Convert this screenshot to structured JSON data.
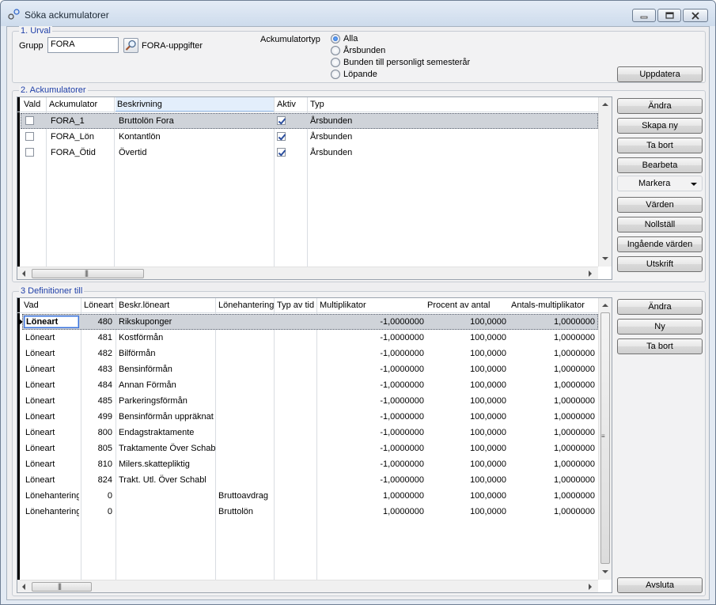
{
  "window": {
    "title": "Söka ackumulatorer",
    "minimize_icon": "minimize-icon",
    "maximize_icon": "maximize-icon",
    "close_icon": "close-icon"
  },
  "urval": {
    "legend": "1. Urval",
    "grupp_label": "Grupp",
    "grupp_value": "FORA",
    "lookup_icon": "search-icon",
    "grupp_description": "FORA-uppgifter",
    "ackumulatortyp_label": "Ackumulatortyp",
    "options": [
      {
        "label": "Alla",
        "selected": true
      },
      {
        "label": "Årsbunden",
        "selected": false
      },
      {
        "label": "Bunden till personligt semesterår",
        "selected": false
      },
      {
        "label": "Löpande",
        "selected": false
      }
    ],
    "update_button": "Uppdatera"
  },
  "ackumulatorer": {
    "legend": "2. Ackumulatorer",
    "columns": [
      "Vald",
      "Ackumulator",
      "Beskrivning",
      "Aktiv",
      "Typ"
    ],
    "rows": [
      {
        "vald": false,
        "ackumulator": "FORA_1",
        "beskrivning": "Bruttolön Fora",
        "aktiv": true,
        "typ": "Årsbunden",
        "selected": true
      },
      {
        "vald": false,
        "ackumulator": "FORA_Lön",
        "beskrivning": "Kontantlön",
        "aktiv": true,
        "typ": "Årsbunden",
        "selected": false
      },
      {
        "vald": false,
        "ackumulator": "FORA_Ötid",
        "beskrivning": "Övertid",
        "aktiv": true,
        "typ": "Årsbunden",
        "selected": false
      }
    ],
    "buttons": [
      "Ändra",
      "Skapa ny",
      "Ta bort",
      "Bearbeta",
      "Markera",
      "Värden",
      "Nollställ",
      "Ingående värden",
      "Utskrift"
    ]
  },
  "definitioner": {
    "legend": "3 Definitioner till",
    "columns": [
      "Vad",
      "Löneart",
      "Beskr.löneart",
      "Lönehantering",
      "Typ av tid",
      "Multiplikator",
      "Procent av antal",
      "Antals-multiplikator"
    ],
    "rows": [
      {
        "vad": "Löneart",
        "loneart": "480",
        "beskr": "Rikskuponger",
        "lonehantering": "",
        "typ": "",
        "mult": "-1,0000000",
        "procent": "100,0000",
        "antal": "1,0000000",
        "selected": true
      },
      {
        "vad": "Löneart",
        "loneart": "481",
        "beskr": "Kostförmån",
        "lonehantering": "",
        "typ": "",
        "mult": "-1,0000000",
        "procent": "100,0000",
        "antal": "1,0000000"
      },
      {
        "vad": "Löneart",
        "loneart": "482",
        "beskr": "Bilförmån",
        "lonehantering": "",
        "typ": "",
        "mult": "-1,0000000",
        "procent": "100,0000",
        "antal": "1,0000000"
      },
      {
        "vad": "Löneart",
        "loneart": "483",
        "beskr": "Bensinförmån",
        "lonehantering": "",
        "typ": "",
        "mult": "-1,0000000",
        "procent": "100,0000",
        "antal": "1,0000000"
      },
      {
        "vad": "Löneart",
        "loneart": "484",
        "beskr": "Annan Förmån",
        "lonehantering": "",
        "typ": "",
        "mult": "-1,0000000",
        "procent": "100,0000",
        "antal": "1,0000000"
      },
      {
        "vad": "Löneart",
        "loneart": "485",
        "beskr": "Parkeringsförmån",
        "lonehantering": "",
        "typ": "",
        "mult": "-1,0000000",
        "procent": "100,0000",
        "antal": "1,0000000"
      },
      {
        "vad": "Löneart",
        "loneart": "499",
        "beskr": "Bensinförmån uppräknat",
        "lonehantering": "",
        "typ": "",
        "mult": "-1,0000000",
        "procent": "100,0000",
        "antal": "1,0000000"
      },
      {
        "vad": "Löneart",
        "loneart": "800",
        "beskr": "Endagstraktamente",
        "lonehantering": "",
        "typ": "",
        "mult": "-1,0000000",
        "procent": "100,0000",
        "antal": "1,0000000"
      },
      {
        "vad": "Löneart",
        "loneart": "805",
        "beskr": "Traktamente Över Schabl",
        "lonehantering": "",
        "typ": "",
        "mult": "-1,0000000",
        "procent": "100,0000",
        "antal": "1,0000000"
      },
      {
        "vad": "Löneart",
        "loneart": "810",
        "beskr": "Milers.skattepliktig",
        "lonehantering": "",
        "typ": "",
        "mult": "-1,0000000",
        "procent": "100,0000",
        "antal": "1,0000000"
      },
      {
        "vad": "Löneart",
        "loneart": "824",
        "beskr": "Trakt. Utl. Över Schabl",
        "lonehantering": "",
        "typ": "",
        "mult": "-1,0000000",
        "procent": "100,0000",
        "antal": "1,0000000"
      },
      {
        "vad": "Lönehantering",
        "loneart": "0",
        "beskr": "",
        "lonehantering": "Bruttoavdrag",
        "typ": "",
        "mult": "1,0000000",
        "procent": "100,0000",
        "antal": "1,0000000"
      },
      {
        "vad": "Lönehantering",
        "loneart": "0",
        "beskr": "",
        "lonehantering": "Bruttolön",
        "typ": "",
        "mult": "1,0000000",
        "procent": "100,0000",
        "antal": "1,0000000"
      }
    ],
    "buttons": [
      "Ändra",
      "Ny",
      "Ta bort"
    ]
  },
  "footer": {
    "close_button": "Avsluta"
  }
}
